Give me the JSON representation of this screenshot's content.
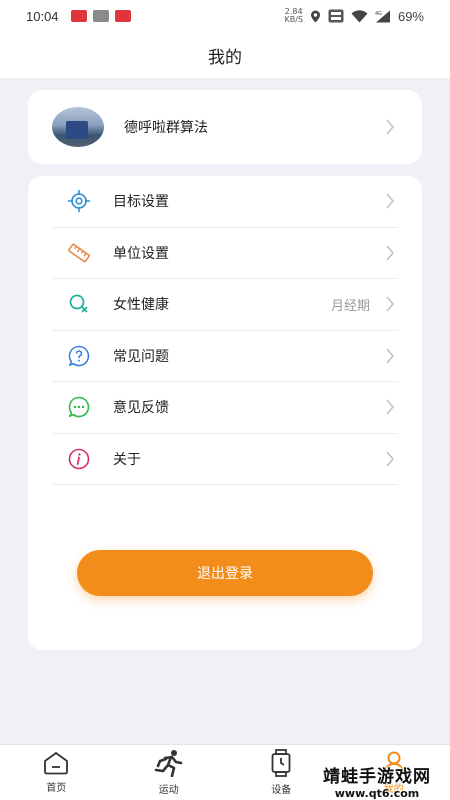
{
  "status_bar": {
    "time": "10:04",
    "net_speed_value": "2.84",
    "net_speed_unit": "KB/S",
    "battery": "69%"
  },
  "header": {
    "title": "我的"
  },
  "profile": {
    "name": "德呼啦群算法"
  },
  "menu": {
    "items": [
      {
        "label": "目标设置",
        "icon": "target-icon",
        "color": "#2b8fd6"
      },
      {
        "label": "单位设置",
        "icon": "ruler-icon",
        "color": "#e8894c"
      },
      {
        "label": "女性健康",
        "icon": "female-icon",
        "color": "#1fb09a",
        "value": "月经期"
      },
      {
        "label": "常见问题",
        "icon": "question-icon",
        "color": "#3b7fe0"
      },
      {
        "label": "意见反馈",
        "icon": "chat-icon",
        "color": "#2cb84a"
      },
      {
        "label": "关于",
        "icon": "info-icon",
        "color": "#d9306b"
      }
    ]
  },
  "logout_label": "退出登录",
  "tabs": [
    {
      "label": "首页",
      "icon": "home-icon"
    },
    {
      "label": "运动",
      "icon": "running-icon"
    },
    {
      "label": "设备",
      "icon": "watch-icon"
    },
    {
      "label": "我的",
      "icon": "profile-icon",
      "active": true
    }
  ],
  "watermark": {
    "title": "靖蛙手游戏网",
    "url": "www.qt6.com"
  },
  "colors": {
    "accent": "#f28c1a",
    "background": "#eff1f7"
  }
}
